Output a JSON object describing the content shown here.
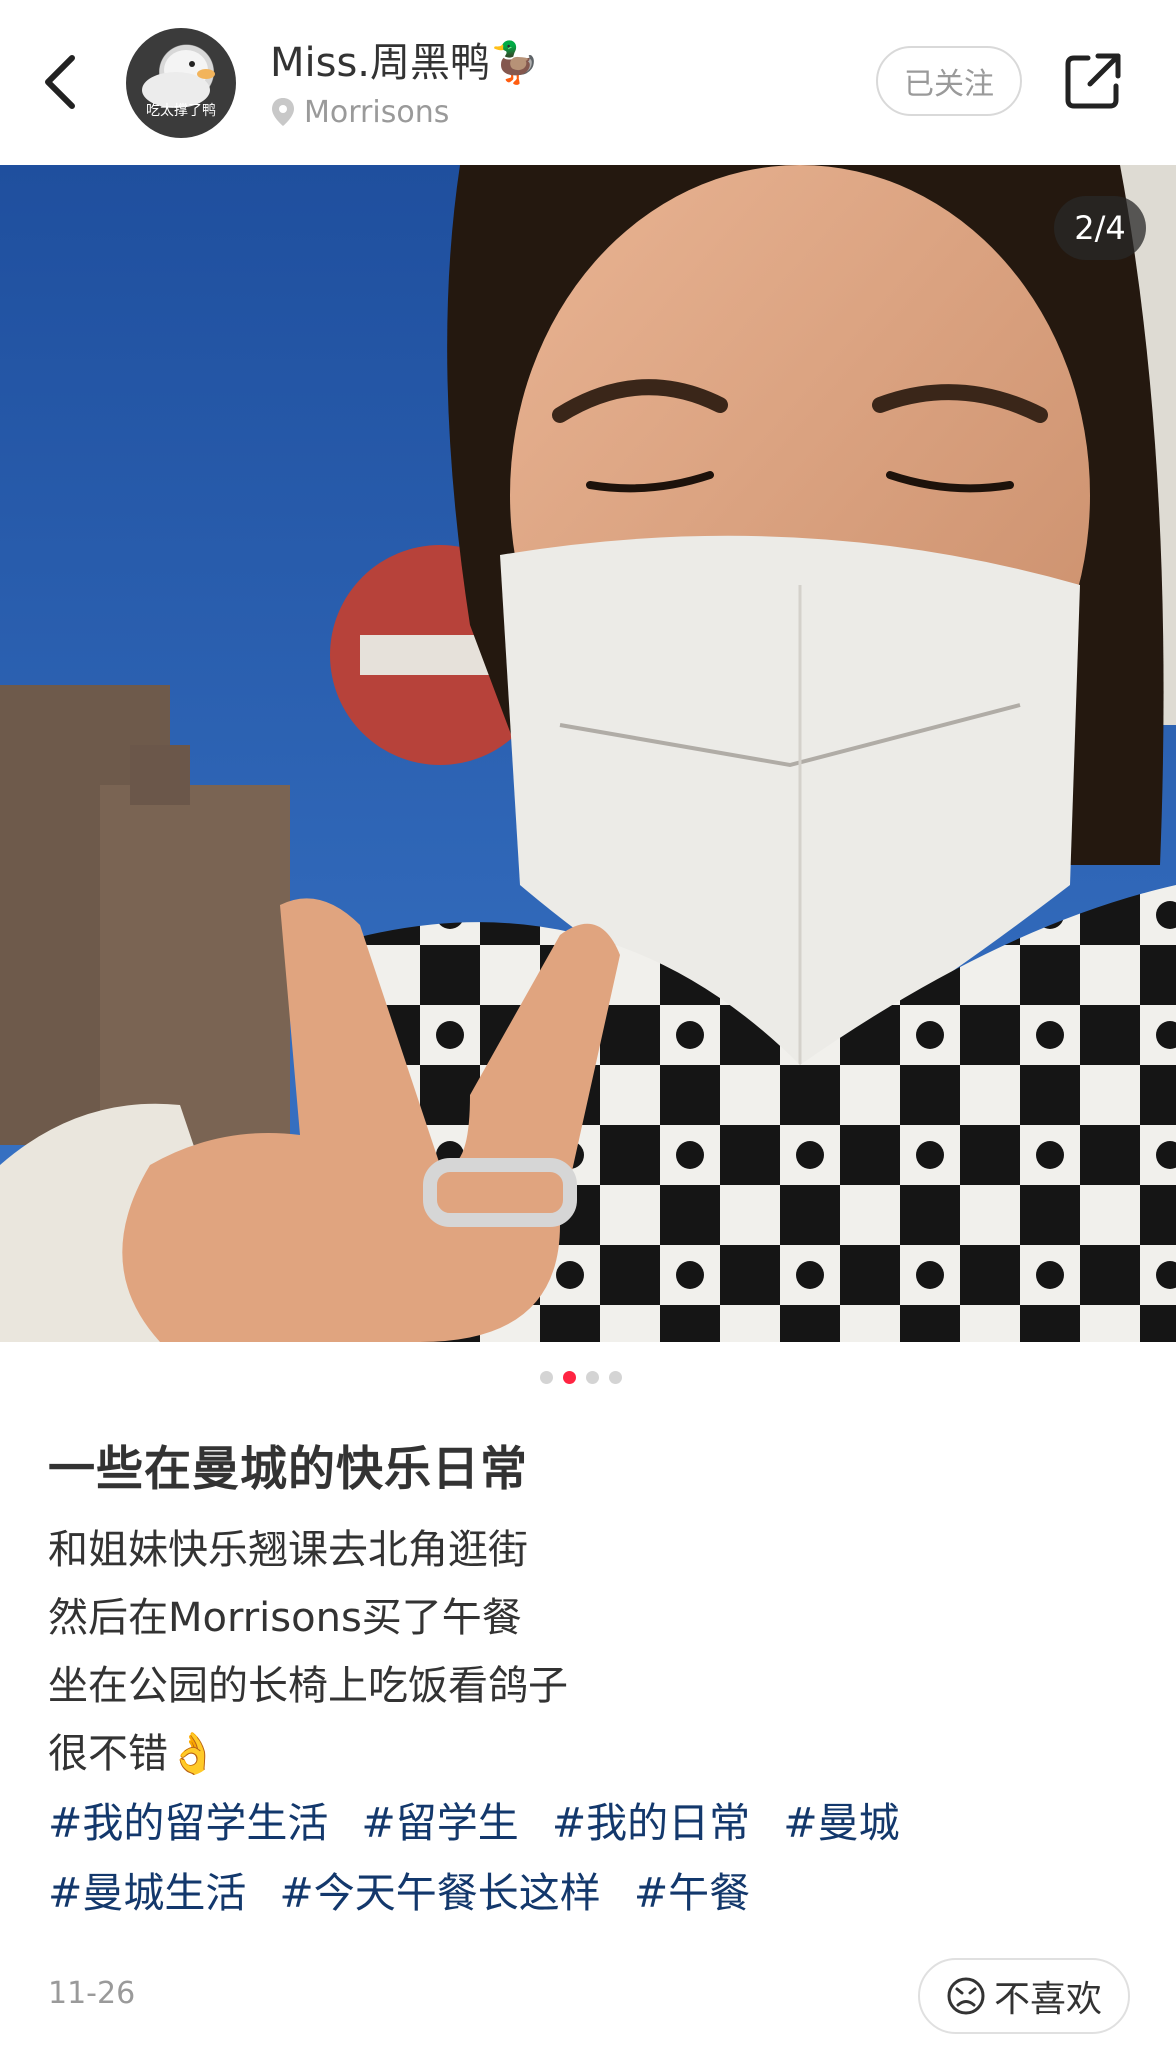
{
  "header": {
    "back_icon": "chevron-left-icon",
    "avatar_caption": "吃太撑了鸭",
    "user_name": "Miss.周黑鸭🦆",
    "location": "Morrisons",
    "location_icon": "map-pin-icon",
    "follow_label": "已关注",
    "share_icon": "share-icon"
  },
  "media": {
    "counter": "2/4",
    "dots": [
      {
        "active": false
      },
      {
        "active": true
      },
      {
        "active": false
      },
      {
        "active": false
      }
    ]
  },
  "post": {
    "title": "一些在曼城的快乐日常",
    "lines": [
      "和姐妹快乐翘课去北角逛街",
      "然后在Morrisons买了午餐",
      "坐在公园的长椅上吃饭看鸽子",
      "很不错👌"
    ],
    "tags": [
      "#我的留学生活",
      "#留学生",
      "#我的日常",
      "#曼城",
      "#曼城生活",
      "#今天午餐长这样",
      "#午餐"
    ],
    "date": "11-26",
    "dislike_label": "不喜欢",
    "dislike_icon": "frown-face-icon"
  },
  "colors": {
    "accent": "#ff2442",
    "tag": "#13386c",
    "muted": "#9a9a9a"
  }
}
